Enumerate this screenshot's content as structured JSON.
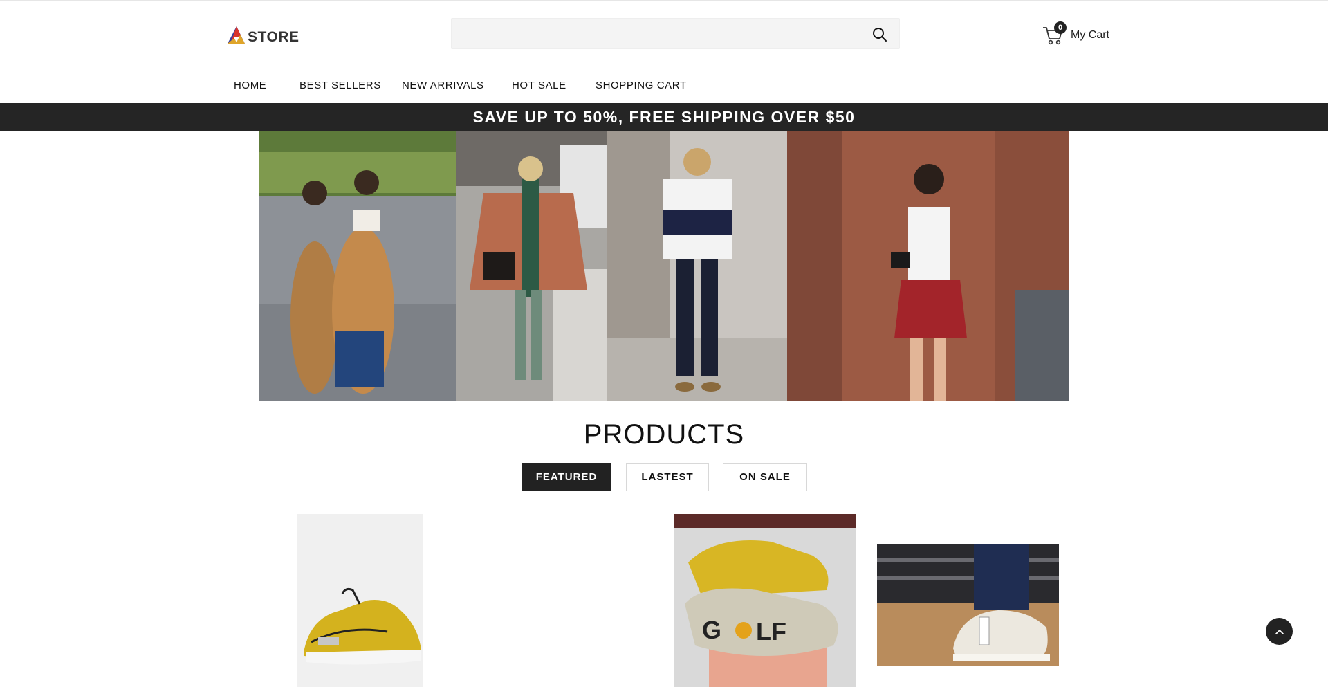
{
  "header": {
    "logo_text": "STORE",
    "search": {
      "placeholder": "",
      "value": ""
    },
    "cart": {
      "count": "0",
      "label": "My Cart"
    }
  },
  "nav": {
    "items": [
      {
        "label": "HOME"
      },
      {
        "label": "BEST SELLERS"
      },
      {
        "label": "NEW ARRIVALS"
      },
      {
        "label": "HOT SALE"
      },
      {
        "label": "SHOPPING CART"
      }
    ]
  },
  "promo": {
    "text": "SAVE UP TO 50%, FREE SHIPPING OVER $50"
  },
  "products_section": {
    "title": "PRODUCTS",
    "tabs": [
      {
        "label": "FEATURED",
        "active": true
      },
      {
        "label": "LASTEST",
        "active": false
      },
      {
        "label": "ON SALE",
        "active": false
      }
    ]
  },
  "colors": {
    "dark": "#222222",
    "promo_bg": "#252525",
    "search_bg": "#f4f4f4",
    "logo_blue": "#3b3f9c",
    "logo_red": "#d9342b",
    "logo_yellow": "#f2b01e"
  }
}
